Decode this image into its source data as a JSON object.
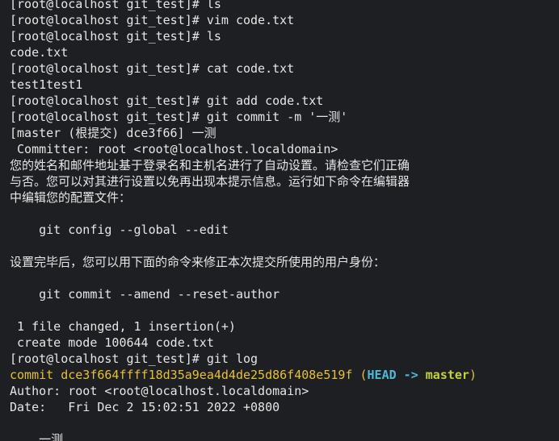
{
  "terminal": {
    "lines": [
      "[root@localhost git_test]# ls",
      "[root@localhost git_test]# vim code.txt",
      "[root@localhost git_test]# ls",
      "code.txt",
      "[root@localhost git_test]# cat code.txt",
      "test1test1",
      "[root@localhost git_test]# git add code.txt",
      "[root@localhost git_test]# git commit -m '一测'",
      "[master (根提交) dce3f66] 一测",
      " Committer: root <root@localhost.localdomain>",
      "您的姓名和邮件地址基于登录名和主机名进行了自动设置。请检查它们正确",
      "与否。您可以对其进行设置以免再出现本提示信息。运行如下命令在编辑器",
      "中编辑您的配置文件：",
      "",
      "    git config --global --edit",
      "",
      "设置完毕后，您可以用下面的命令来修正本次提交所使用的用户身份：",
      "",
      "    git commit --amend --reset-author",
      "",
      " 1 file changed, 1 insertion(+)",
      " create mode 100644 code.txt",
      "[root@localhost git_test]# git log"
    ],
    "commit_line": {
      "prefix": "commit dce3f664ffff18d35a9ea4d4de25d86f408e519f (",
      "head": "HEAD ->",
      "space": " ",
      "branch": "master",
      "suffix": ")"
    },
    "after_lines": [
      "Author: root <root@localhost.localdomain>",
      "Date:   Fri Dec 2 15:02:51 2022 +0800",
      "",
      "    一测"
    ]
  },
  "colors": {
    "background": "#1e1f22",
    "text": "#e6e6e6",
    "commit": "#e5c03a",
    "head": "#4fb8d9",
    "branch": "#c4d33d"
  }
}
